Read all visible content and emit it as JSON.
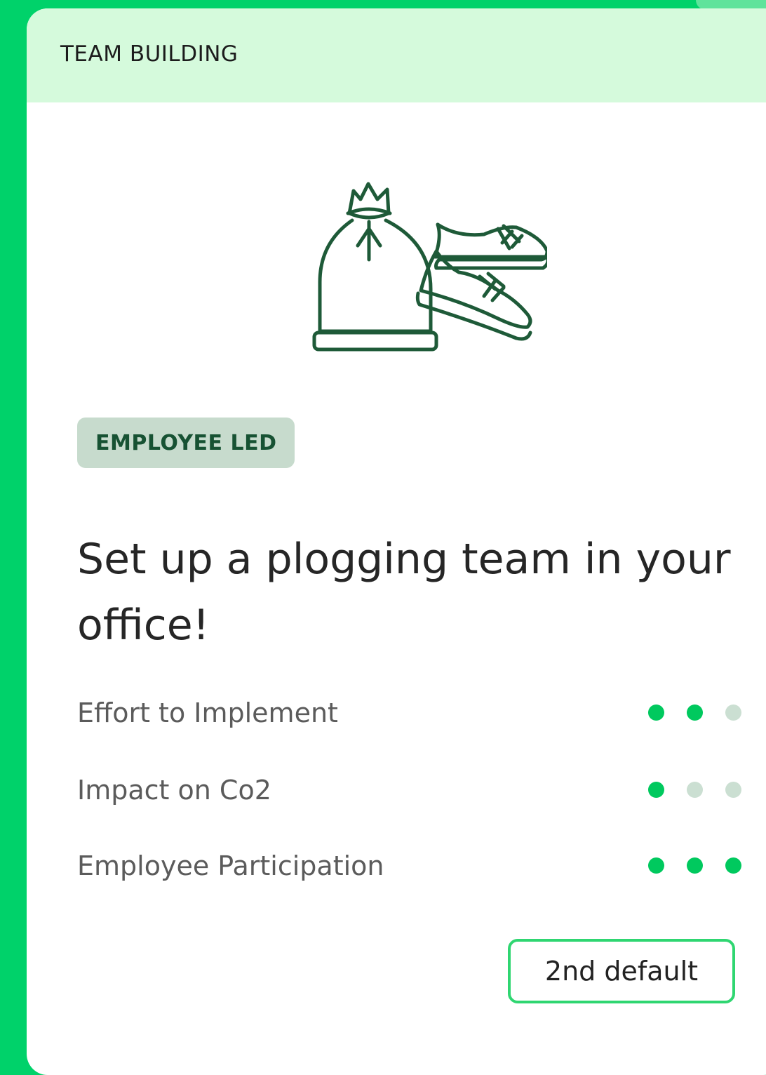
{
  "card": {
    "category": "TEAM BUILDING",
    "illustration_icon": "trash-bag-and-sneakers-icon",
    "badge": "EMPLOYEE LED",
    "title": "Set up a plogging team in your office!",
    "metrics": [
      {
        "label": "Effort to Implement",
        "rating": 2,
        "max": 3
      },
      {
        "label": "Impact on Co2",
        "rating": 1,
        "max": 3
      },
      {
        "label": "Employee Participation",
        "rating": 3,
        "max": 3
      }
    ],
    "button_label": "2nd default"
  },
  "colors": {
    "frame": "#00d26a",
    "header_bg": "#d5fadc",
    "icon": "#1e5a38",
    "badge_bg": "#c7dbcd",
    "badge_text": "#175233",
    "dot_on": "#00c95e",
    "dot_off": "#cbdfd2",
    "button_border": "#2fd671"
  }
}
